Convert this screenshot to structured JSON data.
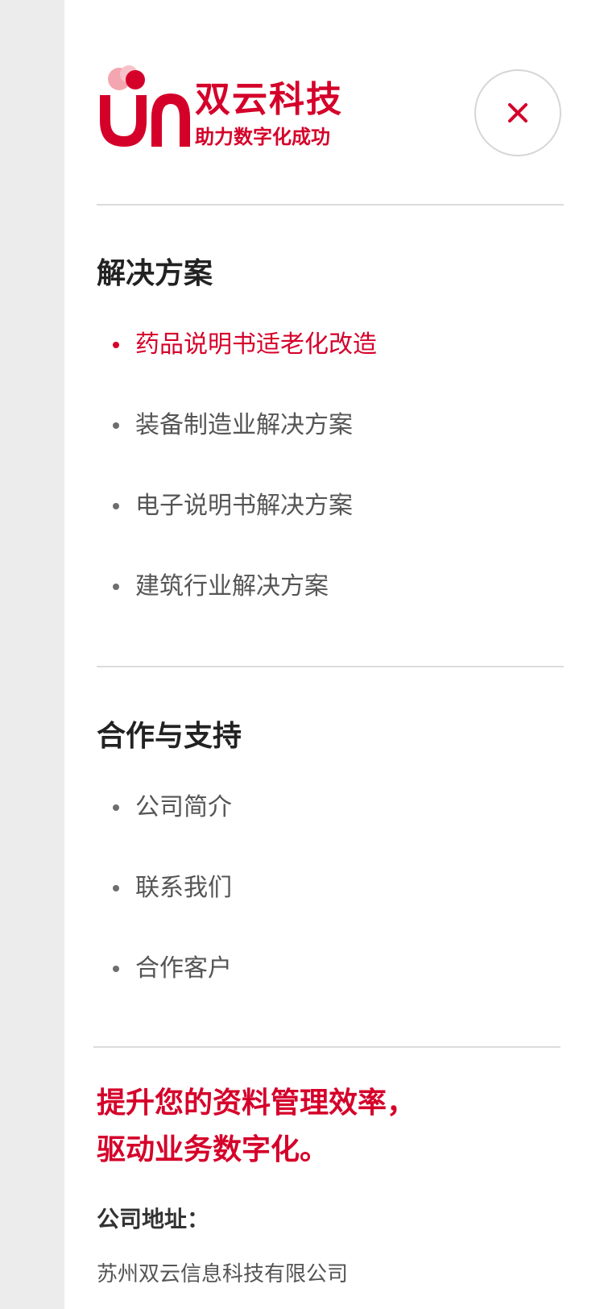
{
  "brand": {
    "name": "双云科技",
    "slogan": "助力数字化成功",
    "accent_color": "#d5002a"
  },
  "header": {
    "close_icon": "close-icon"
  },
  "sections": [
    {
      "title": "解决方案",
      "items": [
        {
          "label": "药品说明书适老化改造",
          "active": true
        },
        {
          "label": "装备制造业解决方案",
          "active": false
        },
        {
          "label": "电子说明书解决方案",
          "active": false
        },
        {
          "label": "建筑行业解决方案",
          "active": false
        }
      ]
    },
    {
      "title": "合作与支持",
      "items": [
        {
          "label": "公司简介",
          "active": false
        },
        {
          "label": "联系我们",
          "active": false
        },
        {
          "label": "合作客户",
          "active": false
        }
      ]
    }
  ],
  "promo": {
    "line1": "提升您的资料管理效率，",
    "line2": "驱动业务数字化。"
  },
  "footer": {
    "address_label": "公司地址：",
    "address_value": "苏州双云信息科技有限公司"
  }
}
